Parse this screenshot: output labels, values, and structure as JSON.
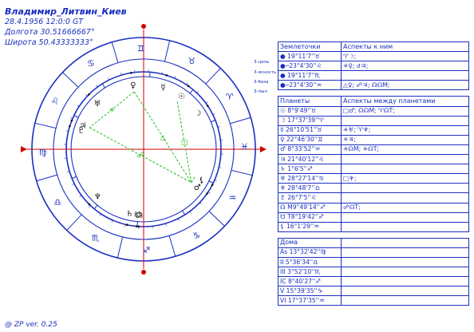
{
  "header": {
    "name": "Владимир_Литвин_Киев",
    "datetime": "28.4.1956 12:0:0 GT",
    "longitude": "Долгота 30.51666667°",
    "latitude": "Широта 50.43333333°"
  },
  "footer": "@ ZP  ver. 0.25",
  "side_labels": [
    "3-цель",
    "3-ясность",
    "3-база",
    "3-пыл"
  ],
  "wheel": {
    "zodiac": [
      {
        "name": "aries",
        "glyph": "♈"
      },
      {
        "name": "taurus",
        "glyph": "♉"
      },
      {
        "name": "gemini",
        "glyph": "♊"
      },
      {
        "name": "cancer",
        "glyph": "♋"
      },
      {
        "name": "leo",
        "glyph": "♌"
      },
      {
        "name": "virgo",
        "glyph": "♍"
      },
      {
        "name": "libra",
        "glyph": "♎"
      },
      {
        "name": "scorpio",
        "glyph": "♏"
      },
      {
        "name": "sagittarius",
        "glyph": "♐"
      },
      {
        "name": "capricorn",
        "glyph": "♑"
      },
      {
        "name": "aquarius",
        "glyph": "♒"
      },
      {
        "name": "pisces",
        "glyph": "♓"
      }
    ],
    "planets": [
      {
        "name": "sun",
        "glyph": "☉"
      },
      {
        "name": "moon",
        "glyph": "☽"
      },
      {
        "name": "mercury",
        "glyph": "☿"
      },
      {
        "name": "venus",
        "glyph": "♀"
      },
      {
        "name": "mars",
        "glyph": "♂"
      },
      {
        "name": "jupiter",
        "glyph": "♃"
      },
      {
        "name": "saturn",
        "glyph": "♄"
      },
      {
        "name": "uranus",
        "glyph": "♅"
      },
      {
        "name": "neptune",
        "glyph": "♆"
      },
      {
        "name": "pluto",
        "glyph": "♇"
      },
      {
        "name": "node",
        "glyph": "☊"
      },
      {
        "name": "south-node",
        "glyph": "☋"
      },
      {
        "name": "lilith",
        "glyph": "⚸"
      }
    ],
    "aspect_symbols": [
      "✳",
      "△",
      "☍",
      "□"
    ],
    "colors": {
      "chart": "#1a2fbf",
      "axis": "#d00000",
      "aspect": "#22bb22",
      "house": "#1a2fbf"
    }
  },
  "table": {
    "sec1": {
      "h1": "Землеточки",
      "h2": "Аспекты к ним"
    },
    "points": [
      {
        "p": "● 19°11'7''♉",
        "a": "♈☽;"
      },
      {
        "p": "●─23°4'30''♌",
        "a": "✳♀; ☌♃;"
      },
      {
        "p": "● 19°11'7''♏",
        "a": ""
      },
      {
        "p": "●─23°4'30''♒",
        "a": "△♀; ☍♃; ☊☊М;"
      }
    ],
    "sec2": {
      "h1": "Планеты",
      "h2": "Аспекты между планетами"
    },
    "planets": [
      {
        "p": "☉ 8°9'49''♉",
        "a": "□♂; ☊☊М; ♈☊Т;"
      },
      {
        "p": "☽ 17°37'39''♈",
        "a": ""
      },
      {
        "p": "☿ 26°10'51''♉",
        "a": "✳♅; ♈♆;"
      },
      {
        "p": "♀ 22°46'30''♊",
        "a": "✳♃;"
      },
      {
        "p": "♂ 8°33'52''♒",
        "a": "✳☊М; ✳☊Т;"
      },
      {
        "p": "♃ 21°40'12''♌",
        "a": ""
      },
      {
        "p": "♄ 1°6'5''♐",
        "a": ""
      },
      {
        "p": "♅ 28°27'14''♋",
        "a": "□♆;"
      },
      {
        "p": "♆ 28°48'7''♎",
        "a": ""
      },
      {
        "p": "♇ 26°7'5''♌",
        "a": ""
      },
      {
        "p": "☊ М9°49'14''♐",
        "a": "☍☊Т;"
      },
      {
        "p": "☋ Т8°19'42''♐",
        "a": ""
      },
      {
        "p": "⚸ 16°1'29''♒",
        "a": ""
      }
    ],
    "sec3": {
      "h1": "Дома",
      "h2": ""
    },
    "houses": [
      {
        "p": "As 13°32'42''♍"
      },
      {
        "p": "II 5°36'34''♎"
      },
      {
        "p": "III 3°52'10''♏"
      },
      {
        "p": "IC 8°40'27''♐"
      },
      {
        "p": "V 15°39'35''♑"
      },
      {
        "p": "VI 17°37'35''♒"
      }
    ]
  }
}
